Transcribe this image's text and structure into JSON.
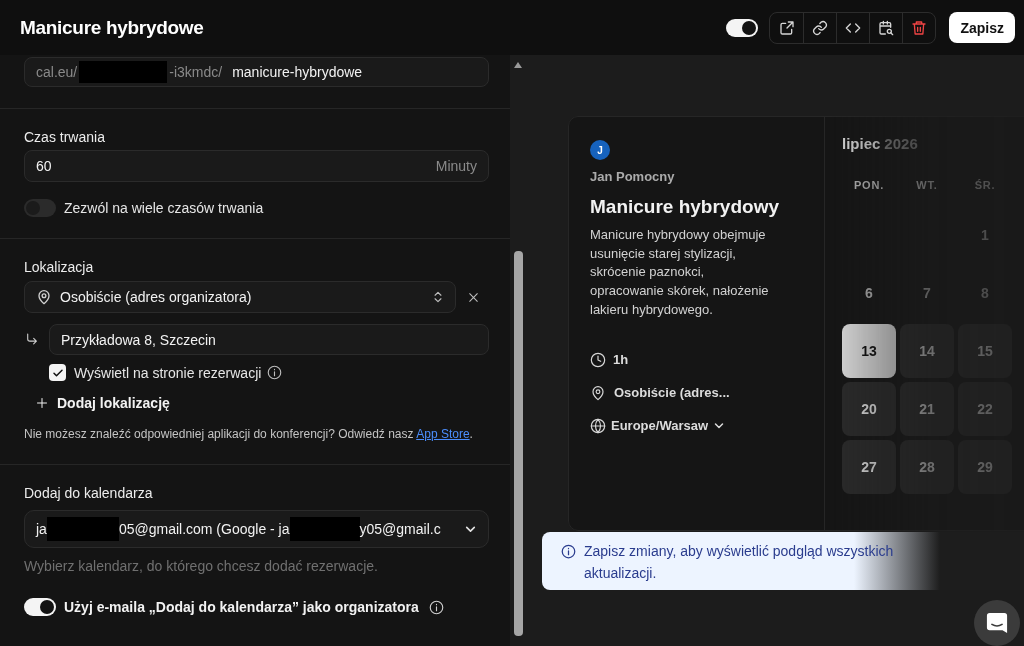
{
  "header": {
    "title": "Manicure hybrydowe",
    "toggle": {
      "on": true
    },
    "save_button": "Zapisz"
  },
  "link": {
    "prefix_start": "cal.eu/",
    "prefix_end": "-i3kmdc/",
    "slug": "manicure-hybrydowe"
  },
  "duration": {
    "label": "Czas trwania",
    "value": "60",
    "unit": "Minuty",
    "multiple_durations": {
      "label": "Zezwól na wiele czasów trwania",
      "on": false
    }
  },
  "location": {
    "label": "Lokalizacja",
    "type": "Osobiście (adres organizatora)",
    "address": "Przykładowa 8, Szczecin",
    "display_on_booking_page": {
      "label": "Wyświetl na stronie rezerwacji",
      "checked": true
    },
    "add_button": "Dodaj lokalizację",
    "note": {
      "text": "Nie możesz znaleźć odpowiedniej aplikacji do konferencji? Odwiedź nasz ",
      "link": "App Store",
      "end": "."
    }
  },
  "add_to_calendar": {
    "label": "Dodaj do kalendarza",
    "value_parts": [
      "ja",
      "05@gmail.com (Google - ja",
      "y05@gmail.c"
    ],
    "hint": "Wybierz kalendarz, do którego chcesz dodać rezerwacje.",
    "organizer_toggle": {
      "label": "Użyj e-maila „Dodaj do kalendarza” jako organizatora",
      "on": true
    }
  },
  "preview": {
    "avatar": "J",
    "host": "Jan Pomocny",
    "title": "Manicure hybrydowy",
    "description": "Manicure hybrydowy obejmuje usunięcie starej stylizacji, skrócenie paznokci, opracowanie skórek, nałożenie lakieru hybrydowego.",
    "details": [
      {
        "kind": "duration",
        "text": "1h"
      },
      {
        "kind": "location",
        "text": "Osobiście (adres..."
      },
      {
        "kind": "timezone",
        "text": "Europe/Warsaw"
      }
    ],
    "calendar": {
      "month": "lipiec",
      "year": "2026",
      "weekdays": [
        "PON.",
        "WT.",
        "ŚR."
      ],
      "weeks": [
        [
          {
            "kind": "blank"
          },
          {
            "kind": "blank"
          },
          {
            "kind": "day",
            "day": "1",
            "available": false,
            "selected": false
          }
        ],
        [
          {
            "kind": "day",
            "day": "6",
            "available": false,
            "selected": false
          },
          {
            "kind": "day",
            "day": "7",
            "available": false,
            "selected": false
          },
          {
            "kind": "day",
            "day": "8",
            "available": false,
            "selected": false
          }
        ],
        [
          {
            "kind": "day",
            "day": "13",
            "available": true,
            "selected": true
          },
          {
            "kind": "day",
            "day": "14",
            "available": true,
            "selected": false
          },
          {
            "kind": "day",
            "day": "15",
            "available": true,
            "selected": false
          }
        ],
        [
          {
            "kind": "day",
            "day": "20",
            "available": true,
            "selected": false
          },
          {
            "kind": "day",
            "day": "21",
            "available": true,
            "selected": false
          },
          {
            "kind": "day",
            "day": "22",
            "available": true,
            "selected": false
          }
        ],
        [
          {
            "kind": "day",
            "day": "27",
            "available": true,
            "selected": false
          },
          {
            "kind": "day",
            "day": "28",
            "available": true,
            "selected": false
          },
          {
            "kind": "day",
            "day": "29",
            "available": true,
            "selected": false
          }
        ]
      ]
    }
  },
  "toast": {
    "text": "Zapisz zmiany, aby wyświetlić podgląd wszystkich aktualizacji."
  }
}
